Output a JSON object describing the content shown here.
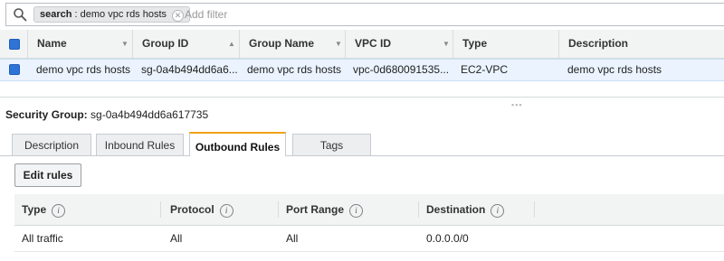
{
  "filter": {
    "token_key": "search",
    "token_value": "demo vpc rds hosts",
    "placeholder": "Add filter"
  },
  "grid": {
    "columns": [
      {
        "label": "Name",
        "sort": "▼"
      },
      {
        "label": "Group ID",
        "sort": "▲"
      },
      {
        "label": "Group Name",
        "sort": "▼"
      },
      {
        "label": "VPC ID",
        "sort": "▼"
      },
      {
        "label": "Type",
        "sort": ""
      },
      {
        "label": "Description",
        "sort": ""
      }
    ],
    "rows": [
      {
        "selected": true,
        "cells": [
          "demo vpc rds hosts",
          "sg-0a4b494dd6a6...",
          "demo vpc rds hosts",
          "vpc-0d680091535...",
          "EC2-VPC",
          "demo vpc rds hosts"
        ]
      }
    ]
  },
  "splitter_grip": "▪▪▪",
  "detail": {
    "label": "Security Group:",
    "value": "sg-0a4b494dd6a617735"
  },
  "tabs": [
    {
      "label": "Description",
      "active": false
    },
    {
      "label": "Inbound Rules",
      "active": false
    },
    {
      "label": "Outbound Rules",
      "active": true
    },
    {
      "label": "Tags",
      "active": false
    }
  ],
  "edit_button": "Edit rules",
  "info_glyph": "i",
  "rules": {
    "headers": [
      "Type",
      "Protocol",
      "Port Range",
      "Destination"
    ],
    "rows": [
      [
        "All traffic",
        "All",
        "All",
        "0.0.0.0/0"
      ]
    ]
  },
  "colors": {
    "accent_tab": "#f0a017",
    "checkbox": "#2e74d6",
    "selected_row": "#eaf3fe"
  }
}
